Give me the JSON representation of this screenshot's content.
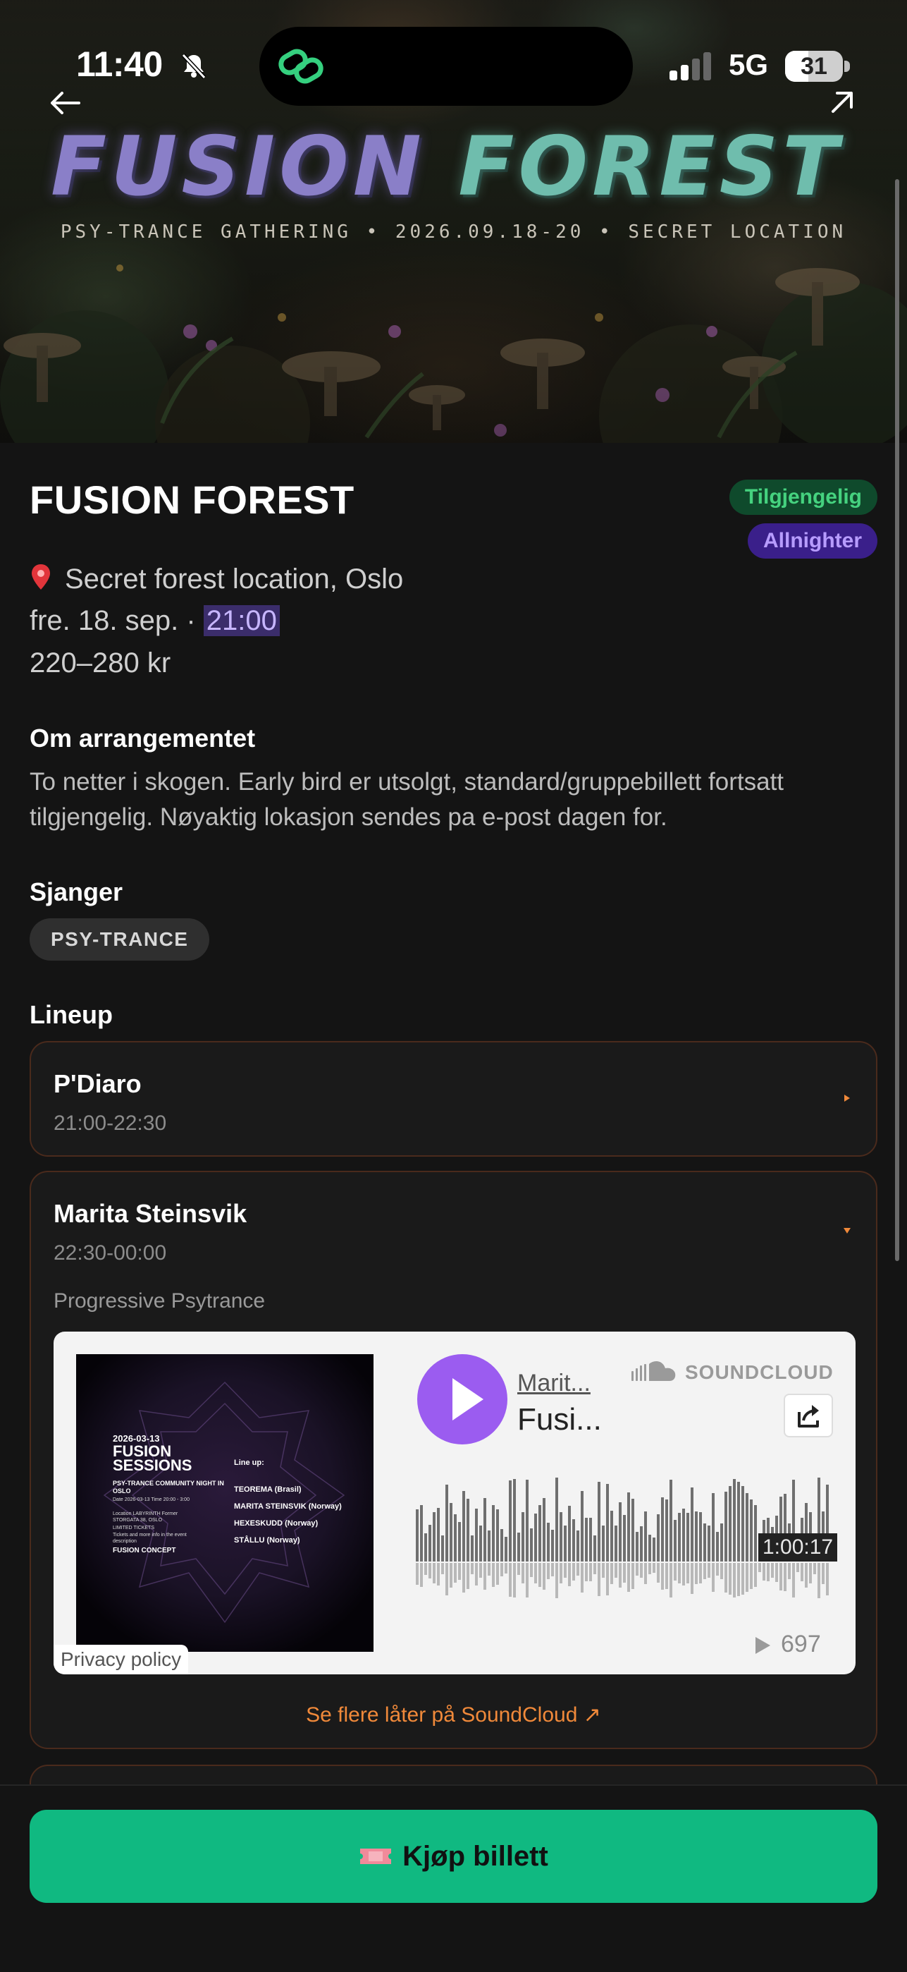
{
  "status_bar": {
    "time": "11:40",
    "network": "5G",
    "battery": "31"
  },
  "hero": {
    "title_word1": "FUSION",
    "title_word2": "FOREST",
    "subtitle": "PSY-TRANCE GATHERING • 2026.09.18-20 • SECRET LOCATION"
  },
  "event": {
    "title": "FUSION FOREST",
    "badges": {
      "available": "Tilgjengelig",
      "allnighter": "Allnighter"
    },
    "location": "Secret forest location, Oslo",
    "date_prefix": "fre. 18. sep. · ",
    "time": "21:00",
    "price": "220–280 kr"
  },
  "about": {
    "heading": "Om arrangementet",
    "text": "To netter i skogen. Early bird er utsolgt, standard/gruppebillett fortsatt tilgjengelig. Nøyaktig lokasjon sendes pa e-post dagen for."
  },
  "genres": {
    "heading": "Sjanger",
    "items": [
      "PSY-TRANCE"
    ]
  },
  "lineup": {
    "heading": "Lineup",
    "artists": [
      {
        "name": "P'Diaro",
        "time": "21:00-22:30"
      },
      {
        "name": "Marita Steinsvik",
        "time": "22:30-00:00",
        "genre": "Progressive Psytrance"
      }
    ]
  },
  "soundcloud": {
    "artist": "Marit...",
    "track": "Fusi...",
    "brand": "SOUNDCLOUD",
    "duration": "1:00:17",
    "plays": "697",
    "privacy": "Privacy policy",
    "more_link": "Se flere låter på SoundCloud ↗",
    "artwork": {
      "date": "2026-03-13",
      "title": "FUSION SESSIONS",
      "subtitle": "PSY-TRANCE COMMUNITY NIGHT IN OSLO",
      "info1": "Date 2026-03-13  Time 20:00 - 3:00",
      "info2": "Location LABYRINTH Former STORGATA 38, OSLO",
      "info3": "LIMITED TICKETS",
      "info4": "Tickets and more info in the event description",
      "lineup_heading": "Line up:",
      "lineup": [
        "TEOREMA (Brasil)",
        "MARITA STEINSVIK (Norway)",
        "HEXESKUDD (Norway)",
        "STÅLLU (Norway)"
      ],
      "logo": "FUSION CONCEPT"
    }
  },
  "buy_button": {
    "label": "Kjøp billett"
  },
  "colors": {
    "accent_green": "#10b981",
    "badge_green_text": "#45d27f",
    "badge_purple_text": "#b79cff",
    "soundcloud_play": "#9b5cf0",
    "link_orange": "#f0893a"
  }
}
